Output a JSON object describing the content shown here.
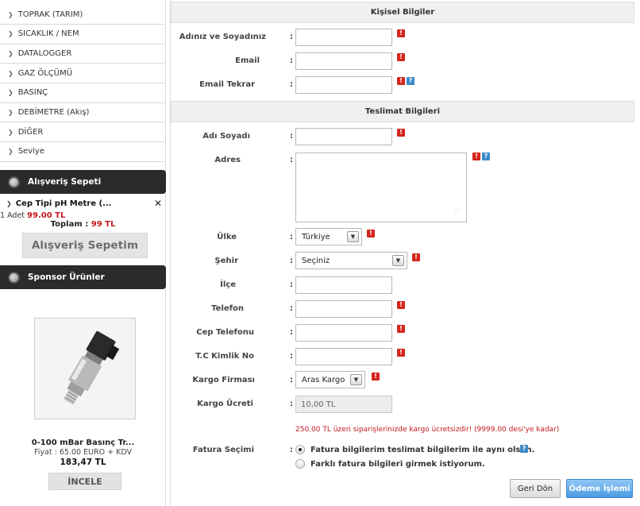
{
  "sidebar": {
    "categories": [
      "TOPRAK (TARIM)",
      "SICAKLIK / NEM",
      "DATALOGGER",
      "GAZ ÖLÇÜMÜ",
      "BASINÇ",
      "DEBİMETRE (Akış)",
      "DİĞER",
      "Seviye"
    ],
    "cart": {
      "title": "Alışveriş Sepeti",
      "item_name": "Cep Tipi pH Metre (...",
      "item_qty": "1",
      "item_unit": "Adet",
      "item_price": "99.00 TL",
      "total_label": "Toplam :",
      "total_value": "99 TL",
      "button_label": "Alışveriş Sepetim"
    },
    "sponsor": {
      "title": "Sponsor Ürünler",
      "product_name": "0-100 mBar Basınç Tr...",
      "product_fiyat": "Fiyat : 65.00 EURO + KDV",
      "product_price": "183,47 TL",
      "button_label": "İNCELE"
    }
  },
  "form": {
    "personal_title": "Kişisel Bilgiler",
    "delivery_title": "Teslimat Bilgileri",
    "colon": ":",
    "labels": {
      "name": "Adınız ve Soyadınız",
      "email": "Email",
      "email_repeat": "Email Tekrar",
      "recipient": "Adı Soyadı",
      "address": "Adres",
      "country": "Ülke",
      "city": "Şehir",
      "district": "İlçe",
      "phone": "Telefon",
      "mobile": "Cep Telefonu",
      "tc": "T.C Kimlik No",
      "cargo_company": "Kargo Firması",
      "cargo_fee": "Kargo Ücreti",
      "invoice": "Fatura Seçimi"
    },
    "values": {
      "name": "",
      "email": "",
      "email_repeat": "",
      "recipient": "",
      "address": "",
      "country": "Türkiye",
      "city": "Seçiniz",
      "district": "",
      "phone": "",
      "mobile": "",
      "tc": "",
      "cargo_company": "Aras Kargo",
      "cargo_fee": "10,00 TL"
    },
    "notice": "250.00 TL üzeri siparişlerinizde kargo ücretsizdir! (9999.00 desi'ye kadar)",
    "invoice_options": [
      "Fatura bilgilerim teslimat bilgilerim ile aynı olsun.",
      "Farklı fatura bilgileri girmek istiyorum."
    ],
    "invoice_selected": 0,
    "buttons": {
      "back": "Geri Dön",
      "pay": "Ödeme İşlemi"
    },
    "icons": {
      "required": "!",
      "help": "?"
    }
  },
  "colors": {
    "header_dark": "#2b2b2b",
    "price_red": "#c4181f",
    "required_red": "#d4261d",
    "help_blue": "#3d8ac7",
    "pay_blue": "#4b9be2"
  }
}
